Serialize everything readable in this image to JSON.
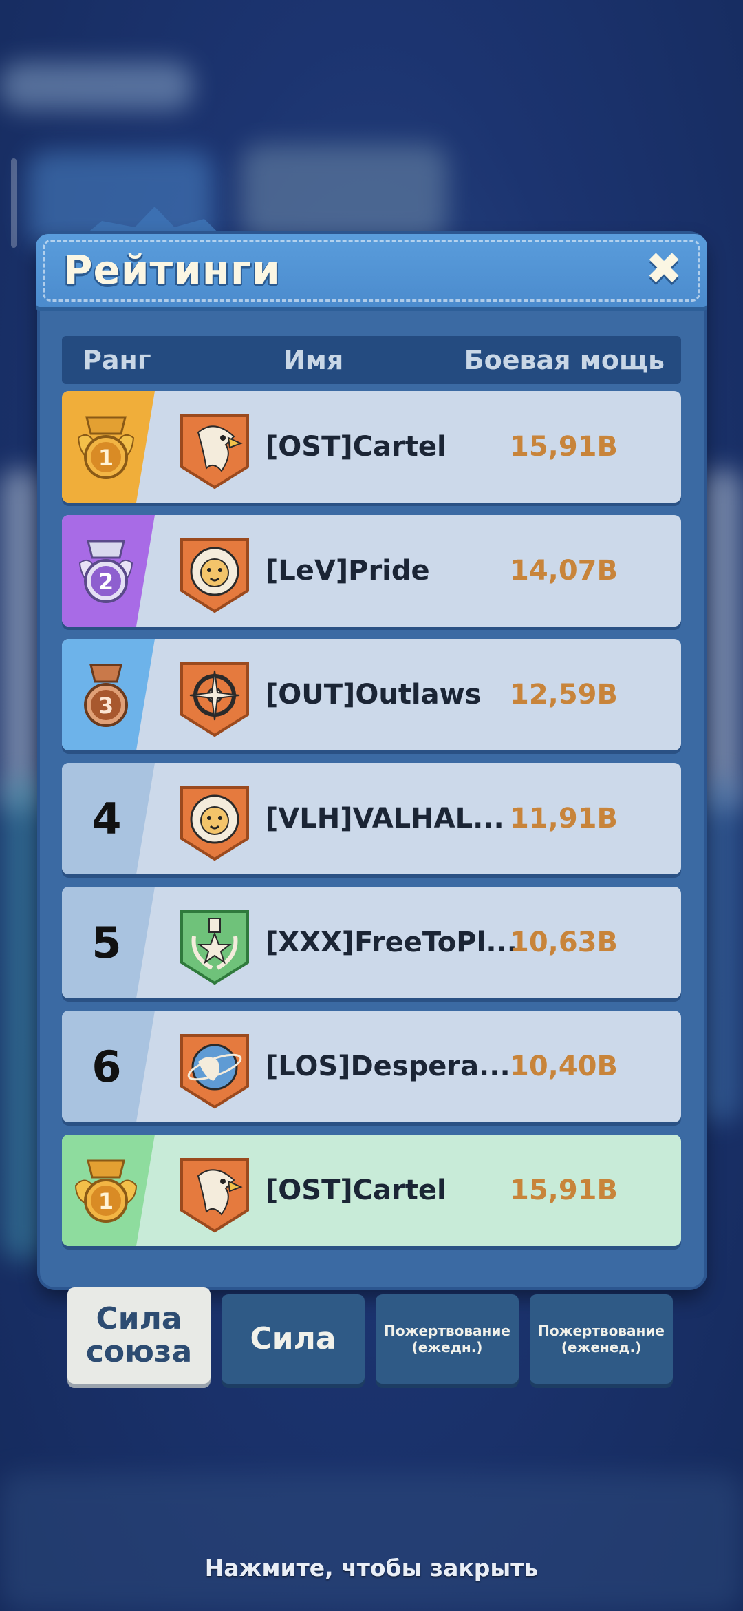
{
  "title": "Рейтинги",
  "close_icon": "close-icon",
  "columns": {
    "rank": "Ранг",
    "name": "Имя",
    "power": "Боевая мощь"
  },
  "rows": [
    {
      "rank": "1",
      "medal": "gold",
      "emblem": "eagle",
      "name": "[OST]Cartel",
      "power": "15,91B"
    },
    {
      "rank": "2",
      "medal": "silver-purple",
      "emblem": "lion",
      "name": "[LeV]Pride",
      "power": "14,07B"
    },
    {
      "rank": "3",
      "medal": "bronze",
      "emblem": "compass",
      "name": "[OUT]Outlaws",
      "power": "12,59B"
    },
    {
      "rank": "4",
      "medal": "",
      "emblem": "lion",
      "name": "[VLH]VALHAL...",
      "power": "11,91B"
    },
    {
      "rank": "5",
      "medal": "",
      "emblem": "star-wreath",
      "name": "[XXX]FreeToPl...",
      "power": "10,63B"
    },
    {
      "rank": "6",
      "medal": "",
      "emblem": "globe",
      "name": "[LOS]Despera...",
      "power": "10,40B"
    }
  ],
  "my_row": {
    "rank": "1",
    "medal": "gold-winged",
    "emblem": "eagle",
    "name": "[OST]Cartel",
    "power": "15,91B"
  },
  "tabs": [
    {
      "label": "Сила союза",
      "active": true
    },
    {
      "label": "Сила",
      "active": false
    },
    {
      "label": "Пожертвование (ежедн.)",
      "active": false
    },
    {
      "label": "Пожертвование (еженед.)",
      "active": false
    }
  ],
  "footer_hint": "Нажмите, чтобы закрыть",
  "colors": {
    "gold_strip": "#f0ae3a",
    "purple_strip": "#a86be6",
    "blue_strip": "#6db3ea",
    "plain_strip": "#a9c3e0",
    "green_strip": "#8edc9e",
    "power_text": "#c8843a",
    "emblem_orange": "#e57a3e",
    "emblem_green": "#6fc27a"
  }
}
